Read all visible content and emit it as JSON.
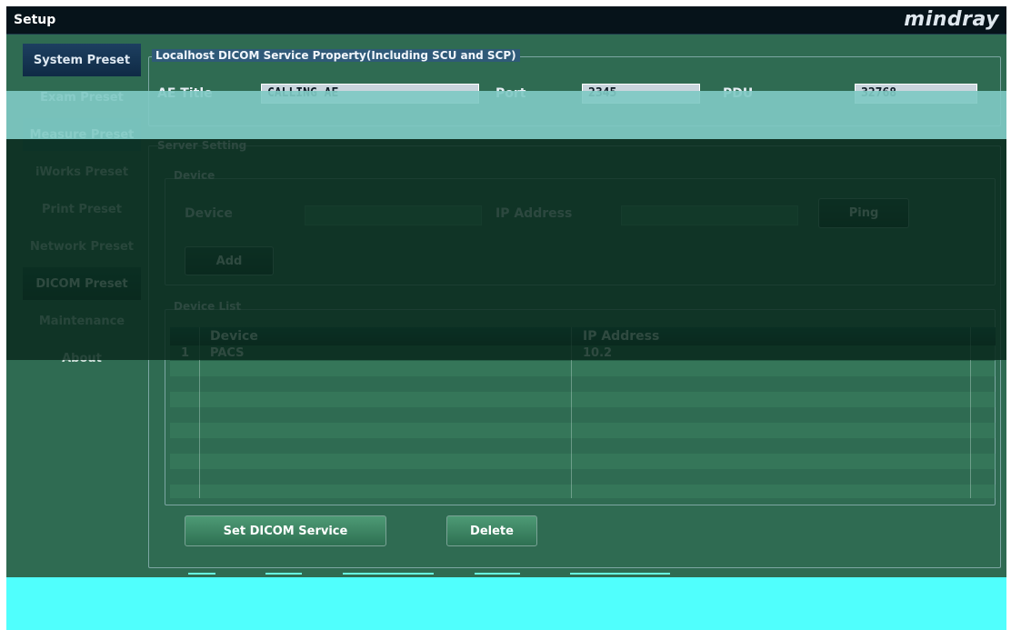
{
  "window": {
    "title": "Setup",
    "brand_logo": "mindray"
  },
  "nav": {
    "items": [
      {
        "label": "System Preset"
      },
      {
        "label": "Exam Preset"
      },
      {
        "label": "Measure Preset"
      },
      {
        "label": "iWorks Preset"
      },
      {
        "label": "Print Preset"
      },
      {
        "label": "Network Preset"
      },
      {
        "label": "DICOM Preset",
        "active": true
      },
      {
        "label": "Maintenance"
      },
      {
        "label": "About"
      }
    ]
  },
  "localhost": {
    "legend": "Localhost DICOM Service Property(Including SCU and SCP)",
    "ae_title_label": "AE Title",
    "ae_title_value": "CALLING AE",
    "port_label": "Port",
    "port_value": "2345",
    "pdu_label": "PDU",
    "pdu_value": "32768"
  },
  "server": {
    "legend": "Server Setting",
    "device_group": {
      "legend": "Device",
      "device_label": "Device",
      "device_value": "",
      "ip_label": "IP Address",
      "ip_value": "",
      "ping_button": "Ping",
      "add_button": "Add"
    },
    "device_list": {
      "legend": "Device List",
      "columns": [
        "Device",
        "IP Address"
      ],
      "rows": [
        {
          "index": "1",
          "device": "PACS",
          "ip": "10.2"
        }
      ]
    },
    "set_dicom_button": "Set DICOM Service",
    "delete_button": "Delete"
  },
  "colors": {
    "background": "#2f6b52",
    "title_bar": "#06131a",
    "input_field": "#c9d5dd",
    "glitch_cyan": "#50fffd",
    "glitch_light": "#7fc9c3"
  }
}
